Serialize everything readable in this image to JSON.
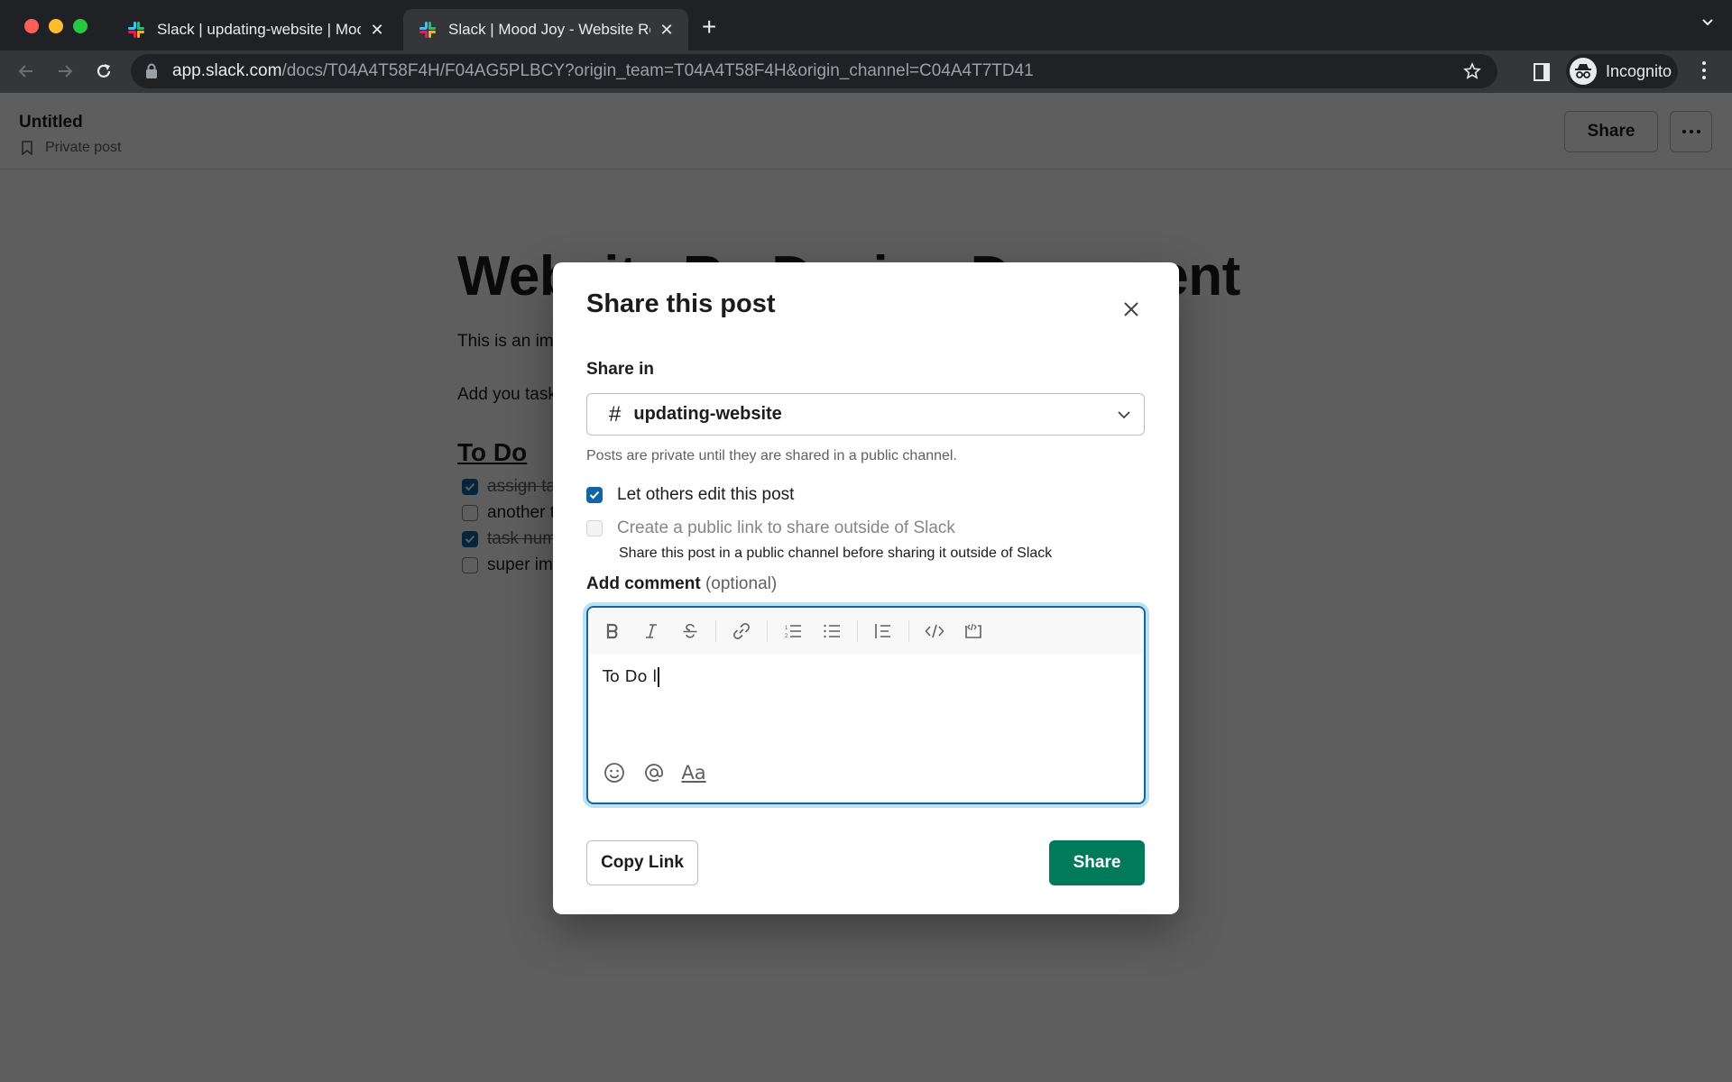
{
  "browser": {
    "tabs": [
      {
        "title": "Slack | updating-website | Mood Joy",
        "active": false,
        "icon": "slack-logo"
      },
      {
        "title": "Slack | Mood Joy - Website Re-Design Document",
        "active": true,
        "icon": "slack-logo"
      }
    ],
    "new_tab_label": "+",
    "url_host": "app.slack.com",
    "url_path": "/docs/T04A4T58F4H/F04AG5PLBCY?origin_team=T04A4T58F4H&origin_channel=C04A4T7TD41",
    "profile_label": "Incognito"
  },
  "doc": {
    "header_title": "Untitled",
    "header_subtitle": "Private post",
    "share_button": "Share",
    "title": "Website Re-Design Document",
    "paragraph1": "This is an important document for the website re-design.",
    "paragraph2": "Add you tasks below.",
    "todo_heading": "To Do",
    "todos": [
      {
        "text": "assign tasks",
        "done": true
      },
      {
        "text": "another task",
        "done": false
      },
      {
        "text": "task number three",
        "done": true
      },
      {
        "text": "super important task",
        "done": false
      }
    ]
  },
  "modal": {
    "title": "Share this post",
    "share_in_label": "Share in",
    "channel_hash": "#",
    "channel_name": "updating-website",
    "hint": "Posts are private until they are shared in a public channel.",
    "options": [
      {
        "label": "Let others edit this post",
        "checked": true,
        "disabled": false
      },
      {
        "label": "Create a public link to share outside of Slack",
        "checked": false,
        "disabled": true
      }
    ],
    "public_link_help": "Share this post in a public channel before sharing it outside of Slack",
    "comment_label": "Add comment",
    "comment_optional": "(optional)",
    "comment_text": "To Do l",
    "format_label": "Aa",
    "copy_link_label": "Copy Link",
    "share_label": "Share",
    "accent_color": "#1264a3",
    "share_color": "#007a5a"
  }
}
